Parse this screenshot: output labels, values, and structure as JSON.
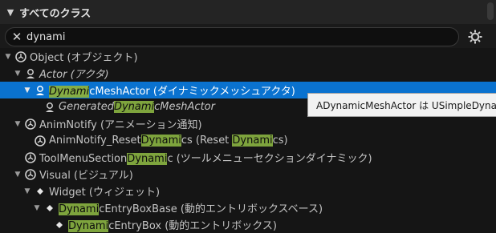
{
  "header": {
    "title": "すべてのクラス"
  },
  "search": {
    "value": "dynami"
  },
  "tree": {
    "object": {
      "label": "Object (オブジェクト)"
    },
    "actor": {
      "label": "Actor (アクタ)"
    },
    "dynamic_mesh_actor": {
      "pre": "",
      "hl": "Dynami",
      "post": "cMeshActor (ダイナミックメッシュアクタ)"
    },
    "generated_dynamic_mesh_actor": {
      "pre": "Generated",
      "hl": "Dynami",
      "post": "cMeshActor"
    },
    "anim_notify": {
      "label": "AnimNotify (アニメーション通知)"
    },
    "anim_notify_reset": {
      "pre": "AnimNotify_Reset",
      "hl": "Dynami",
      "mid": "cs (Reset ",
      "hl2": "Dynami",
      "post": "cs)"
    },
    "tool_menu_section": {
      "pre": "ToolMenuSection",
      "hl": "Dynami",
      "post": "c (ツールメニューセクションダイナミック)"
    },
    "visual": {
      "label": "Visual (ビジュアル)"
    },
    "widget": {
      "label": "Widget (ウィジェット)"
    },
    "dynamic_entry_box_base": {
      "pre": "",
      "hl": "Dynami",
      "post": "cEntryBoxBase (動的エントリボックスベース)"
    },
    "dynamic_entry_box": {
      "pre": "",
      "hl": "Dynami",
      "post": "cEntryBox (動的エントリボックス)"
    }
  },
  "tooltip": {
    "text": "ADynamicMeshActor は USimpleDynamicMeshComponent を利用する"
  },
  "colors": {
    "selection": "#0a72cf",
    "highlight": "#7ea43d",
    "background": "#151515"
  }
}
